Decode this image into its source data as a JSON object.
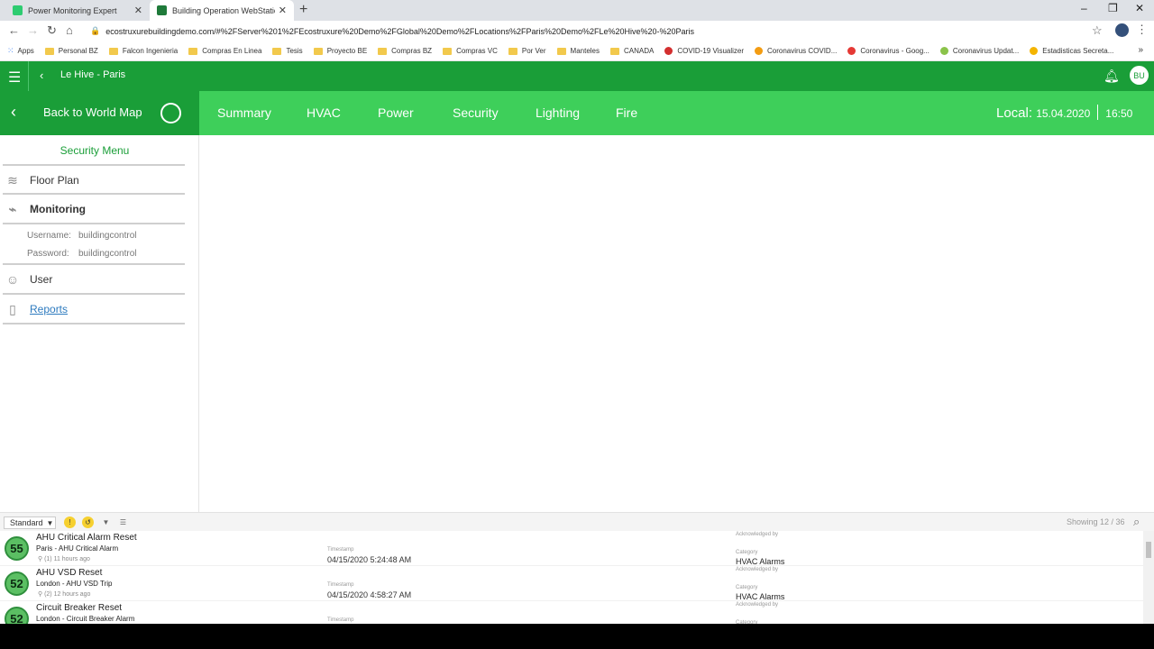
{
  "browser": {
    "tabs": [
      {
        "title": "Power Monitoring Expert",
        "color": "#2ecc71"
      },
      {
        "title": "Building Operation WebStation",
        "color": "#1f7a3a"
      }
    ],
    "url": "ecostruxurebuildingdemo.com/#%2FServer%201%2FEcostruxure%20Demo%2FGlobal%20Demo%2FLocations%2FParis%20Demo%2FLe%20Hive%20-%20Paris",
    "bookmarks": [
      "Apps",
      "Personal BZ",
      "Falcon Ingenieria",
      "Compras En Linea",
      "Tesis",
      "Proyecto BE",
      "Compras BZ",
      "Compras VC",
      "Por Ver",
      "Manteles",
      "CANADA",
      "COVID-19 Visualizer",
      "Coronavirus COVID...",
      "Coronavirus - Goog...",
      "Coronavirus Updat...",
      "Estadisticas Secreta..."
    ]
  },
  "header": {
    "site_title": "Le Hive - Paris",
    "user_initials": "BU"
  },
  "nav": {
    "back_label": "Back to World Map",
    "tabs": [
      "Summary",
      "HVAC",
      "Power",
      "Security",
      "Lighting",
      "Fire"
    ],
    "local_label": "Local:",
    "date": "15.04.2020",
    "time": "16:50"
  },
  "sidebar": {
    "title": "Security Menu",
    "items": [
      "Floor Plan",
      "Monitoring",
      "User",
      "Reports"
    ],
    "username_label": "Username:",
    "username_value": "buildingcontrol",
    "password_label": "Password:",
    "password_value": "buildingcontrol"
  },
  "alarms": {
    "view": "Standard",
    "showing": "Showing 12 / 36",
    "timestamp_label": "Timestamp",
    "ack_label": "Acknowledged by",
    "category_label": "Category",
    "rows": [
      {
        "priority": "55",
        "title": "AHU Critical Alarm Reset",
        "subtitle": "Paris - AHU Critical Alarm",
        "meta": "(1) 11 hours ago",
        "timestamp": "04/15/2020 5:24:48 AM",
        "category": "HVAC Alarms"
      },
      {
        "priority": "52",
        "title": "AHU VSD Reset",
        "subtitle": "London - AHU VSD Trip",
        "meta": "(2) 12 hours ago",
        "timestamp": "04/15/2020 4:58:27 AM",
        "category": "HVAC Alarms"
      },
      {
        "priority": "52",
        "title": "Circuit Breaker Reset",
        "subtitle": "London - Circuit Breaker Alarm",
        "meta": "",
        "timestamp": "",
        "category": ""
      }
    ]
  }
}
